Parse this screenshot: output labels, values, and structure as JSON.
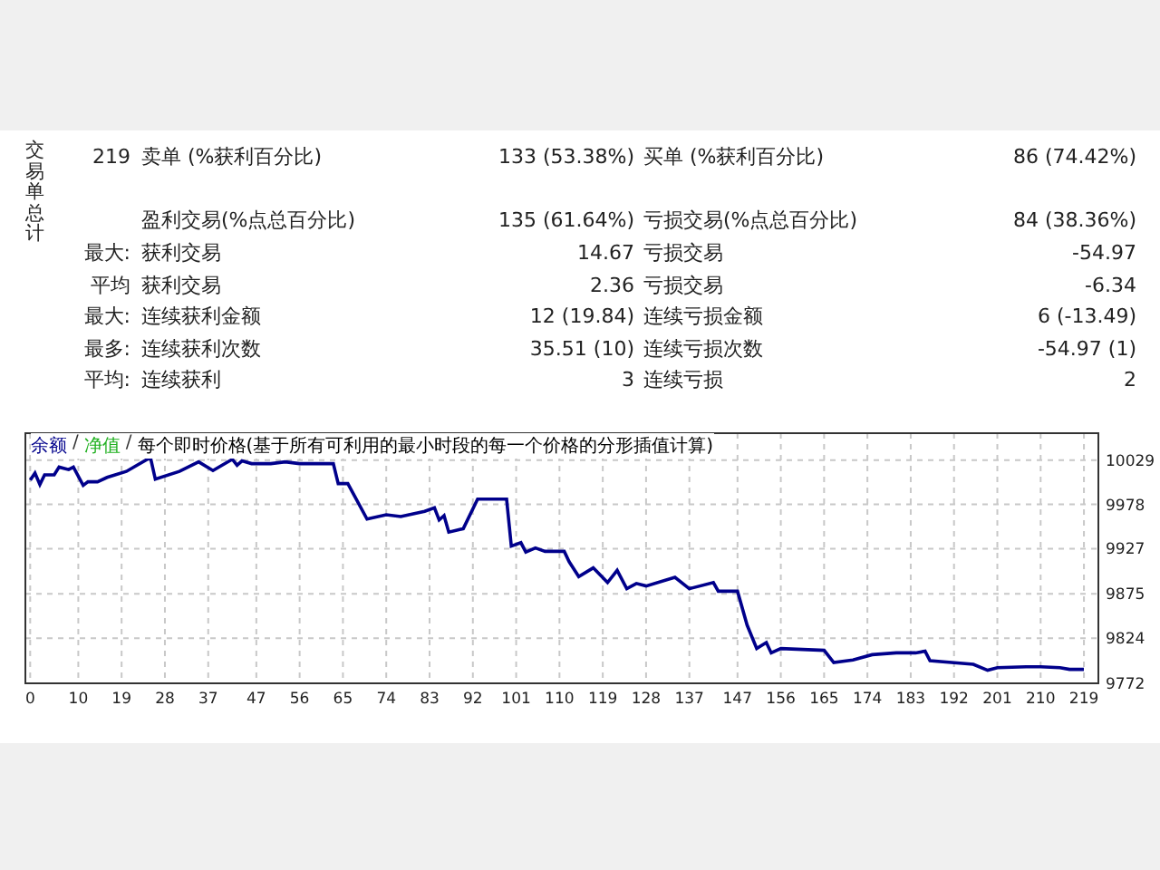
{
  "summary": {
    "label": "交易单总计"
  },
  "totals": {
    "col_a": "219",
    "col_b": "卖单 (%获利百分比)",
    "col_c": "133 (53.38%)",
    "col_d": "买单 (%获利百分比)",
    "col_e": "86 (74.42%)"
  },
  "stats": [
    {
      "col_b": "盈利交易(%点总百分比)",
      "col_c": "135 (61.64%)",
      "col_d": "亏损交易(%点总百分比)",
      "col_e": "84 (38.36%)"
    },
    {
      "col_a": "最大:",
      "col_b": "获利交易",
      "col_c": "14.67",
      "col_d": "亏损交易",
      "col_e": "-54.97"
    },
    {
      "col_a": "平均",
      "col_b": "获利交易",
      "col_c": "2.36",
      "col_d": "亏损交易",
      "col_e": "-6.34"
    },
    {
      "col_a": "最大:",
      "col_b": "连续获利金额",
      "col_c": "12 (19.84)",
      "col_d": "连续亏损金额",
      "col_e": "6 (-13.49)"
    },
    {
      "col_a": "最多:",
      "col_b": "连续获利次数",
      "col_c": "35.51 (10)",
      "col_d": "连续亏损次数",
      "col_e": "-54.97 (1)"
    },
    {
      "col_a": "平均:",
      "col_b": "连续获利",
      "col_c": "3",
      "col_d": "连续亏损",
      "col_e": "2"
    }
  ],
  "chart": {
    "legend": [
      {
        "label": "净值",
        "color": "#20b020"
      },
      {
        "label": "每个即时价格(基于所有可利用的最小时段的每一个价格的分形插值计算)",
        "color": "#000000"
      }
    ],
    "separators": [
      "/",
      "/"
    ],
    "chart_data": {
      "type": "line",
      "x": [
        0,
        1,
        2,
        3,
        5,
        6,
        8,
        9,
        11,
        12,
        14,
        16,
        20,
        25,
        26,
        31,
        35,
        38,
        42,
        43,
        44,
        46,
        50,
        53,
        56,
        63,
        64,
        66,
        70,
        74,
        77,
        82,
        84,
        85,
        86,
        87,
        90,
        93,
        98,
        99,
        100,
        102,
        103,
        105,
        107,
        111,
        112,
        114,
        117,
        120,
        122,
        124,
        126,
        128,
        134,
        137,
        142,
        143,
        147,
        149,
        151,
        153,
        154,
        156,
        165,
        167,
        171,
        175,
        180,
        184,
        186,
        187,
        196,
        199,
        201,
        207,
        210,
        214,
        216,
        219
      ],
      "series": [
        {
          "name": "余额",
          "color": "#00008b",
          "values": [
            10006,
            10014,
            10001,
            10012,
            10012,
            10021,
            10018,
            10021,
            10000,
            10004,
            10004,
            10009,
            10016,
            10032,
            10007,
            10016,
            10027,
            10017,
            10030,
            10023,
            10028,
            10025,
            10025,
            10027,
            10025,
            10025,
            10002,
            10002,
            9961,
            9966,
            9964,
            9970,
            9974,
            9960,
            9965,
            9946,
            9950,
            9984,
            9984,
            9984,
            9930,
            9934,
            9923,
            9928,
            9924,
            9924,
            9912,
            9895,
            9905,
            9888,
            9902,
            9881,
            9887,
            9884,
            9894,
            9881,
            9888,
            9878,
            9878,
            9839,
            9812,
            9819,
            9807,
            9812,
            9810,
            9796,
            9799,
            9805,
            9807,
            9807,
            9809,
            9798,
            9794,
            9787,
            9790,
            9791,
            9791,
            9790,
            9788,
            9788
          ]
        }
      ],
      "xlim": [
        -1,
        222
      ],
      "ylim": [
        9772,
        10060
      ],
      "grid": true,
      "xticks": [
        0,
        10,
        19,
        28,
        37,
        47,
        56,
        65,
        74,
        83,
        92,
        101,
        110,
        119,
        128,
        137,
        147,
        156,
        165,
        174,
        183,
        192,
        201,
        210,
        219
      ],
      "yticks": [
        9772,
        9824,
        9875,
        9927,
        9978,
        10029
      ]
    }
  }
}
